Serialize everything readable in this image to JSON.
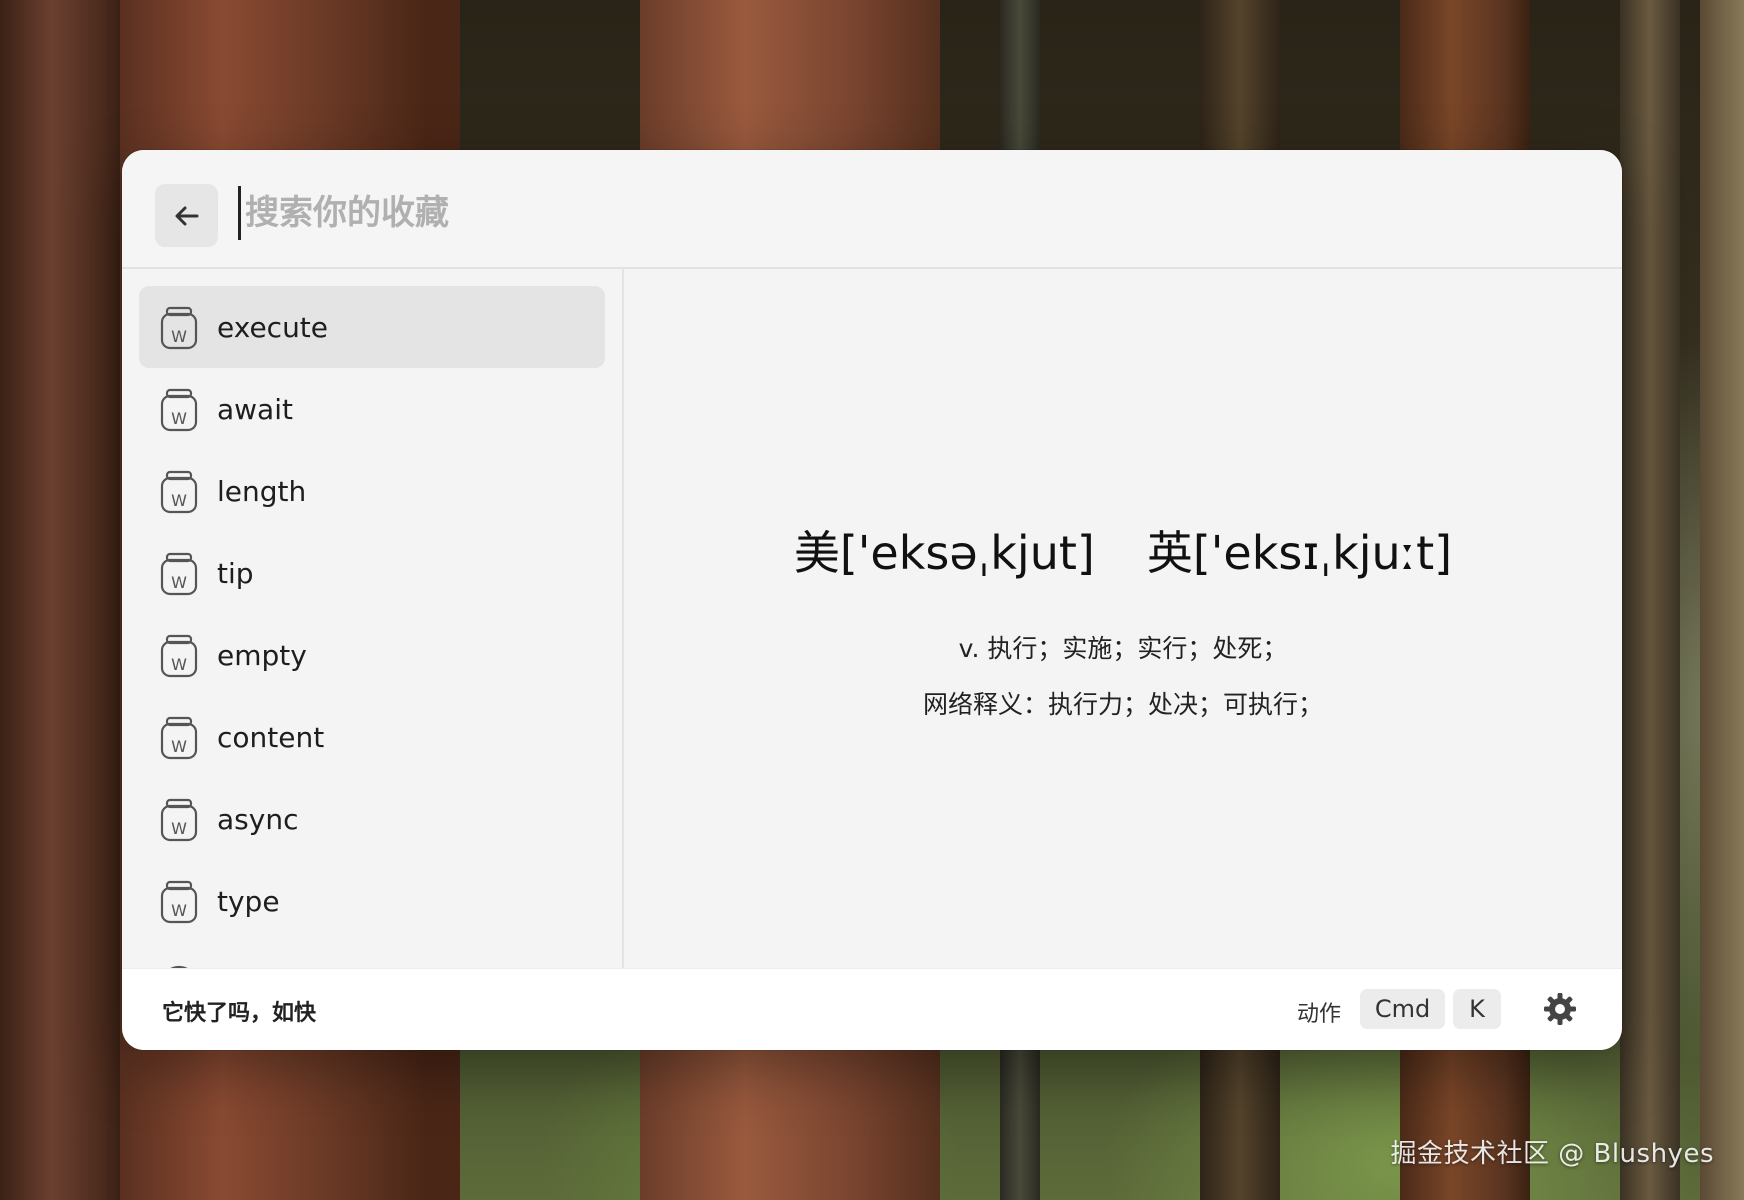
{
  "search": {
    "placeholder": "搜索你的收藏"
  },
  "sidebar": {
    "items": [
      {
        "label": "execute",
        "icon": "word-jar-icon",
        "selected": true
      },
      {
        "label": "await",
        "icon": "word-jar-icon"
      },
      {
        "label": "length",
        "icon": "word-jar-icon"
      },
      {
        "label": "tip",
        "icon": "word-jar-icon"
      },
      {
        "label": "empty",
        "icon": "word-jar-icon"
      },
      {
        "label": "content",
        "icon": "word-jar-icon"
      },
      {
        "label": "async",
        "icon": "word-jar-icon"
      },
      {
        "label": "type",
        "icon": "word-jar-icon"
      }
    ]
  },
  "detail": {
    "us_phonetic": "美['eksəˌkjut]",
    "uk_phonetic": "英['eksɪˌkjuːt]",
    "definition": "v. 执行；实施；实行；处死；",
    "web_definition": "网络释义：执行力；处决；可执行；"
  },
  "footer": {
    "status": "它快了吗，如快",
    "action_label": "动作",
    "keys": [
      "Cmd",
      "K"
    ]
  },
  "watermark": "掘金技术社区 @ Blushyes",
  "colors": {
    "window_bg": "#f4f4f4",
    "selected_bg": "#e4e4e4",
    "footer_bg": "#ffffff"
  }
}
